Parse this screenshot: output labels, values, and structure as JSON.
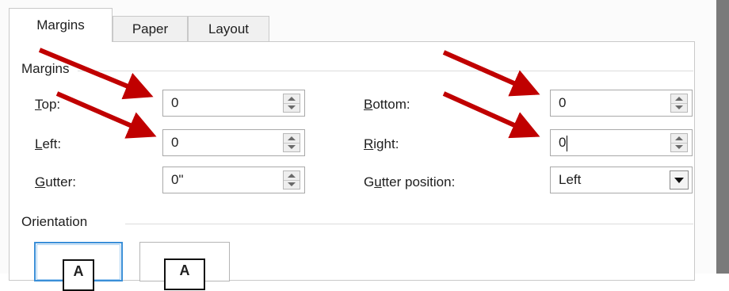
{
  "tabs": [
    {
      "label": "Margins",
      "active": true
    },
    {
      "label": "Paper",
      "active": false
    },
    {
      "label": "Layout",
      "active": false
    }
  ],
  "margins_group": {
    "title": "Margins",
    "top": {
      "label_accel": "T",
      "label_rest": "op:",
      "value": "0"
    },
    "left": {
      "label_accel": "L",
      "label_rest": "eft:",
      "value": "0"
    },
    "gutter": {
      "label_accel": "G",
      "label_rest": "utter:",
      "value": "0\""
    },
    "bottom": {
      "label_accel": "B",
      "label_rest": "ottom:",
      "value": "0"
    },
    "right": {
      "label_accel": "R",
      "label_rest": "ight:",
      "value": "0"
    },
    "gutter_position": {
      "label_pre": "G",
      "label_accel": "u",
      "label_rest": "tter position:",
      "value": "Left"
    }
  },
  "orientation_group": {
    "title": "Orientation",
    "portrait_glyph": "A",
    "landscape_glyph": "A"
  },
  "annotation": {
    "arrow_color": "#c00000",
    "arrow_count": 4
  },
  "colors": {
    "selected_border": "#3a8fd8",
    "arrow": "#c00000"
  }
}
